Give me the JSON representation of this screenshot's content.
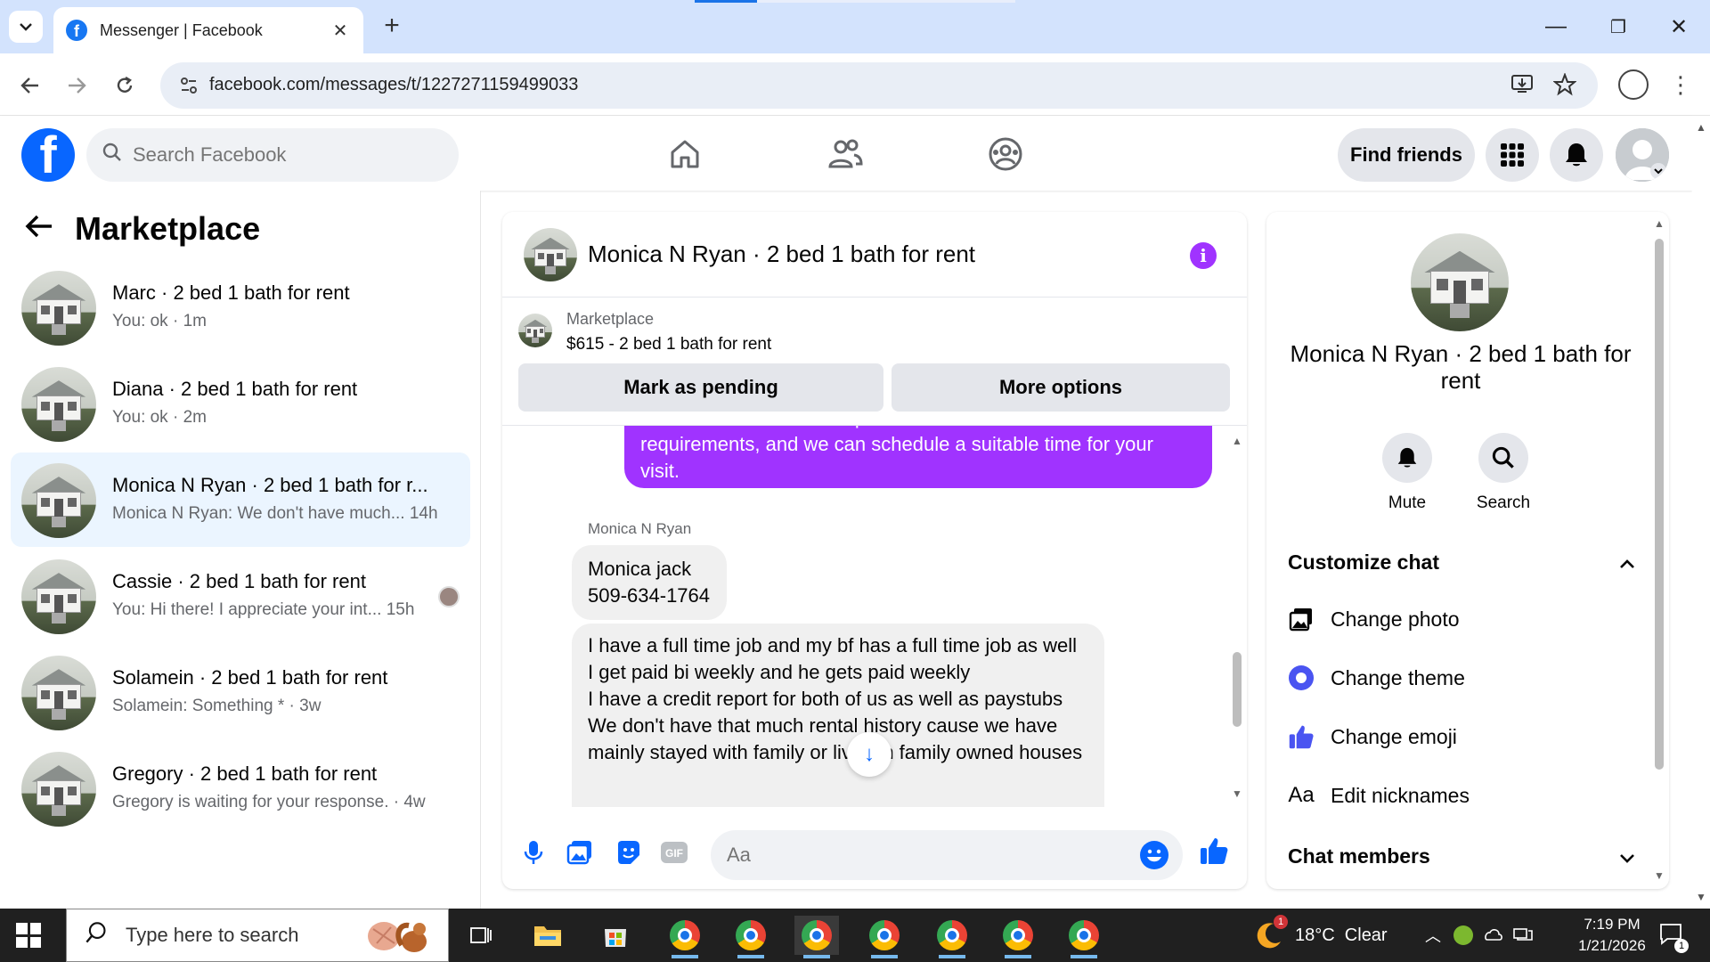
{
  "browser": {
    "tab_title": "Messenger | Facebook",
    "url": "facebook.com/messages/t/1227271159499033",
    "new_tab_symbol": "+",
    "minimize_symbol": "—",
    "maximize_symbol": "❐",
    "close_symbol": "✕",
    "tab_close_symbol": "✕"
  },
  "fb": {
    "logo_letter": "f",
    "search_placeholder": "Search Facebook",
    "find_friends": "Find friends"
  },
  "left": {
    "title": "Marketplace",
    "back_symbol": "←",
    "conversations": [
      {
        "name": "Marc · 2 bed 1 bath for rent",
        "sub": "You: ok · 1m"
      },
      {
        "name": "Diana · 2 bed 1 bath for rent",
        "sub": "You: ok · 2m"
      },
      {
        "name": "Monica N Ryan · 2 bed 1 bath for r...",
        "sub": "Monica N Ryan: We don't have much... 14h"
      },
      {
        "name": "Cassie · 2 bed 1 bath for rent",
        "sub": "You: Hi there! I appreciate your int... 15h"
      },
      {
        "name": "Solamein · 2 bed 1 bath for rent",
        "sub": "Solamein: Something * · 3w"
      },
      {
        "name": "Gregory · 2 bed 1 bath for rent",
        "sub": "Gregory is waiting for your response. · 4w"
      }
    ]
  },
  "chat": {
    "title": "Monica N Ryan · 2 bed 1 bath for rent",
    "info_symbol": "i",
    "marketplace_label": "Marketplace",
    "listing": "$615 - 2 bed 1 bath for rent",
    "mark_pending": "Mark as pending",
    "more_options": "More options",
    "outgoing_text": "contact number so I can provide all the rental details and requirements, and we can schedule a suitable time for your visit.",
    "sender_name": "Monica N Ryan",
    "incoming_1": "Monica jack\n509-634-1764",
    "incoming_2": "I have a full time job and my bf has a full time job as well\nI get paid bi weekly and he gets paid weekly\nI have a credit report for both of us as well as paystubs\nWe don't have that much rental history cause we have mainly stayed with family or lived in family owned houses",
    "composer_placeholder": "Aa",
    "scroll_down_symbol": "↓"
  },
  "info": {
    "name": "Monica N Ryan · 2 bed 1 bath for rent",
    "mute": "Mute",
    "search": "Search",
    "customize_chat": "Customize chat",
    "change_photo": "Change photo",
    "change_theme": "Change theme",
    "change_emoji": "Change emoji",
    "edit_nicknames": "Edit nicknames",
    "nickname_icon_text": "Aa",
    "chat_members": "Chat members",
    "theme_color": "#4a54f1",
    "accent_color": "#a033ff"
  },
  "taskbar": {
    "search_placeholder": "Type here to search",
    "weather": "18°C  Clear",
    "weather_badge": "1",
    "time": "7:19 PM",
    "date": "1/21/2026",
    "notification_count": "1"
  },
  "colors": {
    "fb_blue": "#0866ff",
    "messenger_purple": "#a033ff",
    "active_conv_bg": "#ebf5ff"
  }
}
